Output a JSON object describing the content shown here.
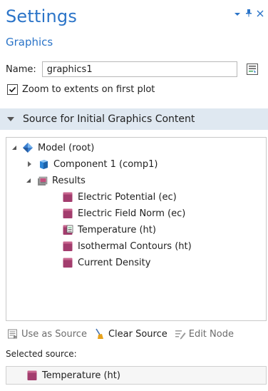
{
  "header": {
    "title": "Settings",
    "subtitle": "Graphics"
  },
  "window_controls": {
    "dropdown_icon": "▾",
    "pin_icon": "pin-icon",
    "close_icon": "×"
  },
  "name_field": {
    "label": "Name:",
    "value": "graphics1"
  },
  "checkbox": {
    "label": "Zoom to extents on first plot",
    "checked": true
  },
  "section": {
    "label": "Source for Initial Graphics Content"
  },
  "tree": {
    "model_root": "Model (root)",
    "component": "Component 1 (comp1)",
    "results": "Results",
    "items": [
      {
        "label": "Electric Potential (ec)",
        "icon": "plot-group-icon"
      },
      {
        "label": "Electric Field Norm (ec)",
        "icon": "plot-group-icon"
      },
      {
        "label": "Temperature (ht)",
        "icon": "plot-group-doc-icon"
      },
      {
        "label": "Isothermal Contours (ht)",
        "icon": "plot-group-icon"
      },
      {
        "label": "Current Density",
        "icon": "plot-group-icon"
      }
    ]
  },
  "toolbar": {
    "use_as_source": "Use as Source",
    "clear_source": "Clear Source",
    "edit_node": "Edit Node"
  },
  "selected": {
    "label": "Selected source:",
    "value": "Temperature (ht)"
  },
  "colors": {
    "accent": "#2b74c8",
    "section_bg": "#dfe8f1",
    "plot_icon": "#a33d6e"
  }
}
